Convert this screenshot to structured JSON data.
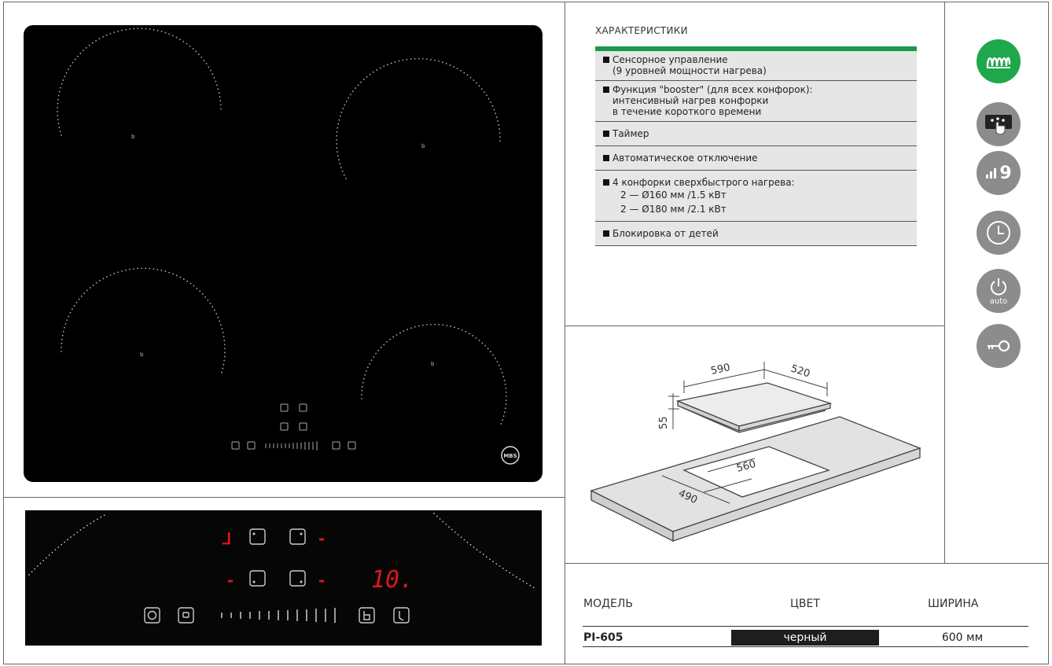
{
  "features": {
    "title": "ХАРАКТЕРИСТИКИ",
    "items": [
      {
        "lines": [
          "Сенсорное управление",
          "(9 уровней мощности нагрева)"
        ]
      },
      {
        "lines": [
          "Функция \"booster\" (для всех конфорок):",
          "интенсивный нагрев конфорки",
          "в течение короткого времени"
        ]
      },
      {
        "lines": [
          "Таймер"
        ]
      },
      {
        "lines": [
          "Автоматическое отключение"
        ]
      },
      {
        "lines": [
          "4 конфорки сверхбыстрого нагрева:"
        ],
        "sub": [
          "2 — Ø160 мм /1.5 кВт",
          "2 — Ø180 мм /2.1 кВт"
        ]
      },
      {
        "lines": [
          "Блокировка от детей"
        ]
      }
    ]
  },
  "icons": {
    "induction": "induction-coil-icon",
    "touch": "touch-control-icon",
    "levels_text": "9",
    "timer": "timer-icon",
    "auto_label": "auto",
    "lock": "key-lock-icon",
    "accent": "#1ea84b"
  },
  "cooktop": {
    "zone_marks": [
      "b",
      "b",
      "b",
      "b"
    ],
    "logo_text": "MBS"
  },
  "panel": {
    "display_left_top": "ᒧ",
    "display_right_big": "10.",
    "dash": "-",
    "display_color": "#e0151a"
  },
  "dimensions": {
    "width": "590",
    "depth": "520",
    "height": "55",
    "cut_width": "560",
    "cut_depth": "490"
  },
  "spec": {
    "headers": {
      "model": "МОДЕЛЬ",
      "color": "ЦВЕТ",
      "width": "ШИРИНА"
    },
    "values": {
      "model": "PI-605",
      "color": "черный",
      "width": "600 мм"
    }
  }
}
